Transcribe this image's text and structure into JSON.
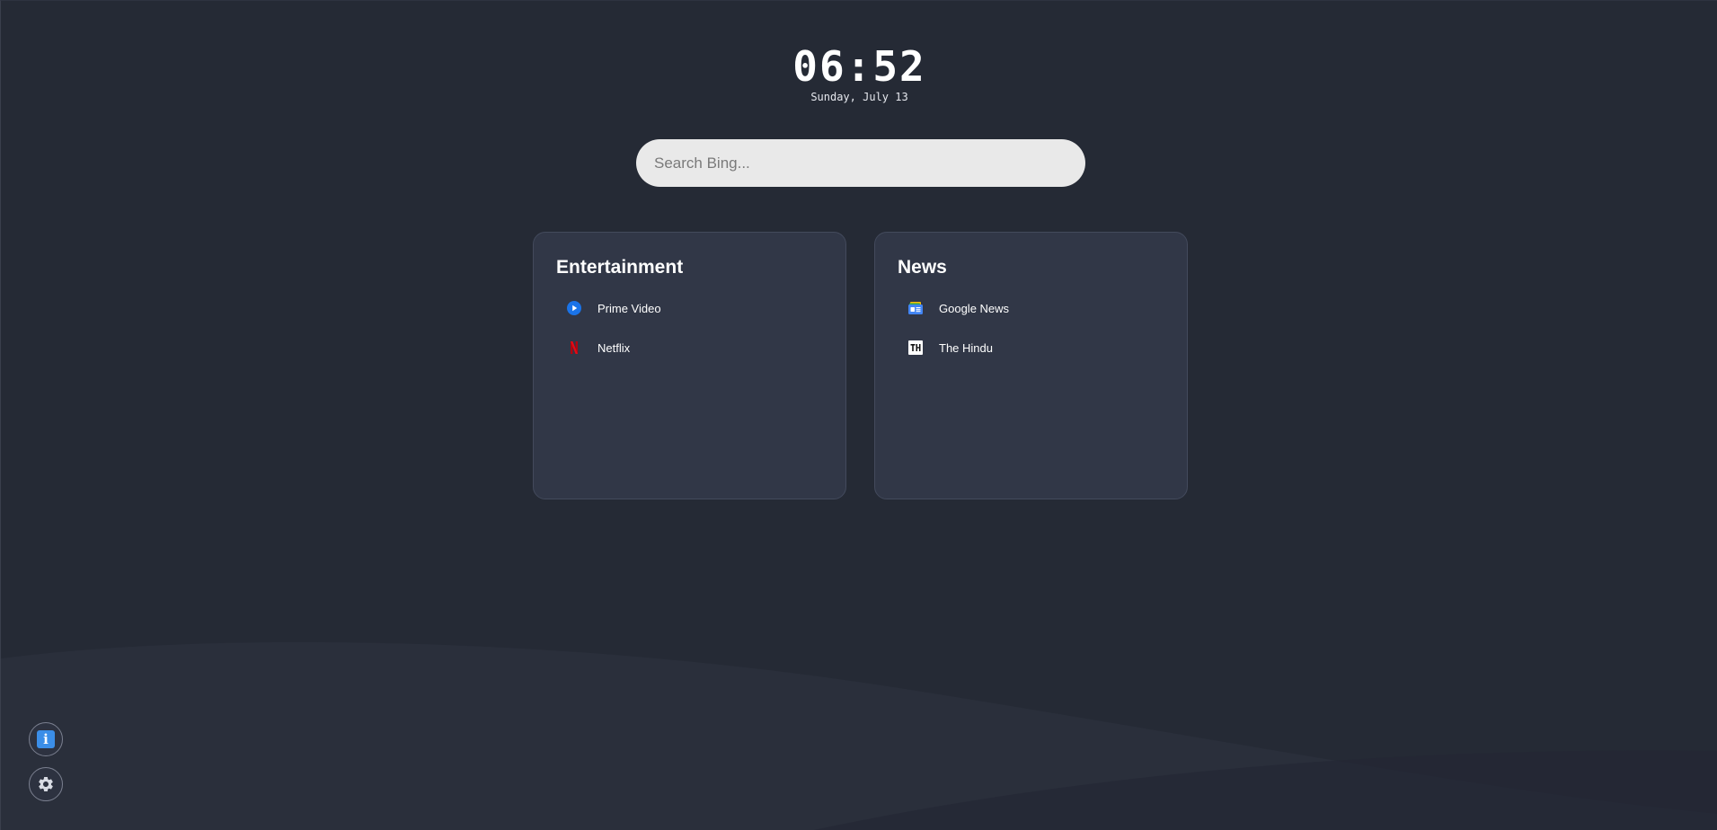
{
  "clock": {
    "time": "06:52",
    "date": "Sunday, July 13"
  },
  "search": {
    "placeholder": "Search Bing...",
    "value": ""
  },
  "cards": [
    {
      "title": "Entertainment",
      "links": [
        {
          "label": "Prime Video",
          "icon": "prime-video-icon"
        },
        {
          "label": "Netflix",
          "icon": "netflix-icon"
        }
      ]
    },
    {
      "title": "News",
      "links": [
        {
          "label": "Google News",
          "icon": "google-news-icon"
        },
        {
          "label": "The Hindu",
          "icon": "the-hindu-icon"
        }
      ]
    }
  ],
  "buttons": {
    "info_icon": "info-icon",
    "settings_icon": "gear-icon"
  },
  "colors": {
    "background": "#252a35",
    "card": "#313747",
    "search_bg": "#e9e9e9",
    "accent_blue": "#3b8ee8",
    "netflix_red": "#e50914"
  }
}
